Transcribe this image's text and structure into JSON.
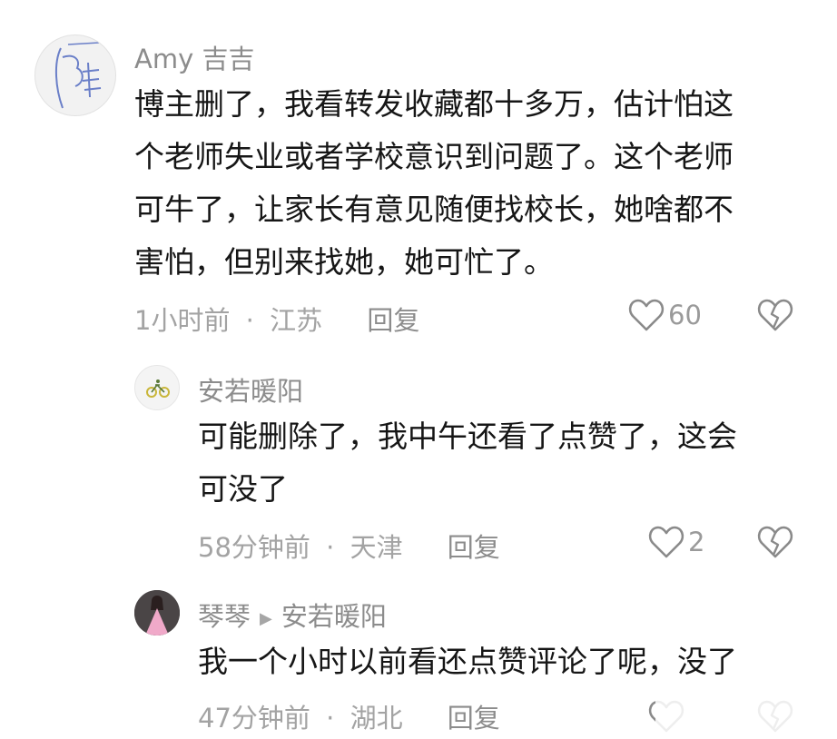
{
  "comments": [
    {
      "username": "Amy 吉吉",
      "content_lines": [
        "博主删了，我看转发收藏都十多万，估计怕这",
        "个老师失业或者学校意识到问题了。这个老师",
        "可牛了，让家长有意见随便找校长，她啥都不",
        "害怕，但别来找她，她可忙了。"
      ],
      "time": "1小时前",
      "location": "江苏",
      "reply_label": "回复",
      "likes": "60",
      "avatar_icon": "sketch-avatar-icon"
    },
    {
      "username": "安若暖阳",
      "content_lines": [
        "可能删除了，我中午还看了点赞了，这会",
        "可没了"
      ],
      "time": "58分钟前",
      "location": "天津",
      "reply_label": "回复",
      "likes": "2",
      "avatar_icon": "bicycle-avatar-icon"
    },
    {
      "username": "琴琴",
      "reply_to": "安若暖阳",
      "content_lines": [
        "我一个小时以前看还点赞评论了呢，没了"
      ],
      "time": "47分钟前",
      "location": "湖北",
      "reply_label": "回复",
      "avatar_icon": "girl-pink-dress-avatar-icon"
    }
  ],
  "separator": "·",
  "colors": {
    "text": "#161616",
    "meta": "#a3a3a3",
    "name": "#8c8c8c",
    "icon": "#8a8a8a"
  }
}
